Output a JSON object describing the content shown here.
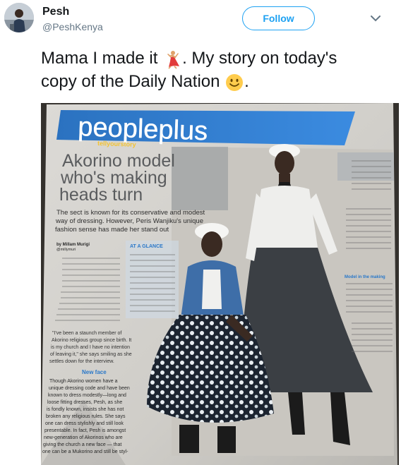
{
  "user": {
    "display_name": "Pesh",
    "handle": "@PeshKenya"
  },
  "actions": {
    "follow_label": "Follow"
  },
  "tweet": {
    "text_line1_a": "Mama I made it ",
    "text_line1_b": ". My story on today's",
    "text_line2": "copy of the Daily Nation ",
    "text_line2_end": "."
  },
  "newspaper": {
    "section_title": "peopleplus",
    "section_tag": "tellyourstory",
    "headline_lines": [
      "Akorino model",
      "who's making",
      "heads turn"
    ],
    "standfirst_lines": [
      "The sect is known for its conservative and modest",
      "way of dressing. However, Peris Wanjiku's unique",
      "fashion sense has made her stand out"
    ],
    "byline": "by Millam Murigi",
    "byline_handle": "@millymuri",
    "at_a_glance": "AT A GLANCE",
    "subhead": "New face",
    "body_lines": [
      "Though Akorino women have a",
      "unique dressing code and have been",
      "known to dress modestly—long and",
      "loose fitting dresses, Pesh, as she",
      "is fondly known, insists she has not",
      "broken any religious rules. She says",
      "one can dress stylishly and still look",
      "presentable. In fact, Pesh is amongst",
      "new-generation of Akorinos who are",
      "giving the church a new face — that",
      "one can be a Mukorino and still be styl-"
    ],
    "quote_lines": [
      "\"I've been a staunch member of",
      "Akorino religious group since birth. It",
      "is my church and I have no intention",
      "of leaving it,\" she says smiling as she",
      "settles down for the interview."
    ],
    "side_subhead": "Model in the making"
  },
  "colors": {
    "accent": "#1da1f2",
    "newspaper_band": "#2a78c9",
    "text": "#14171a",
    "muted": "#657786"
  },
  "icons": {
    "dancer_emoji": "dancer-emoji-icon",
    "smile_emoji": "smiling-face-emoji-icon",
    "caret": "chevron-down-icon"
  }
}
